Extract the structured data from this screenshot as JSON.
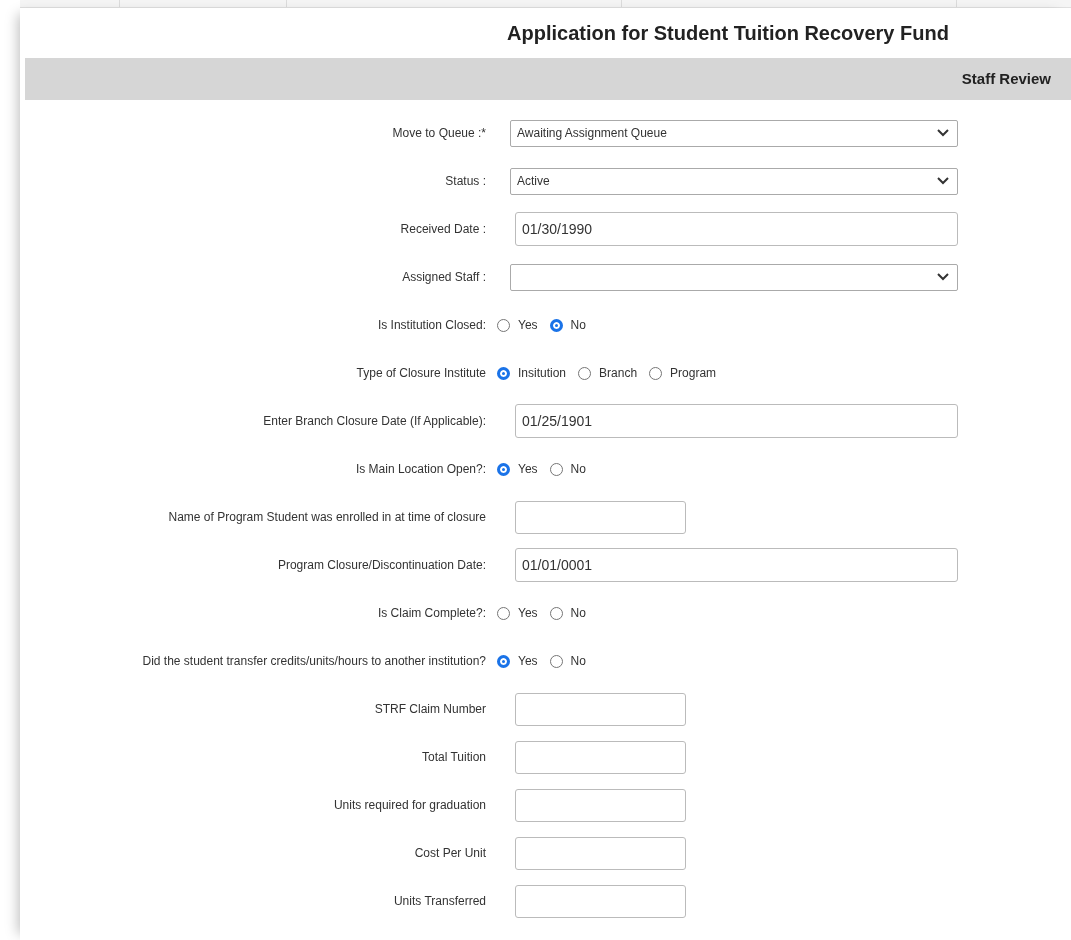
{
  "title": "Application for Student Tuition Recovery Fund",
  "section": "Staff Review",
  "fields": [
    {
      "kind": "select",
      "label": "Move to Queue :*",
      "value": "Awaiting Assignment Queue"
    },
    {
      "kind": "select",
      "label": "Status :",
      "value": "Active"
    },
    {
      "kind": "wide",
      "label": "Received Date :",
      "value": "01/30/1990"
    },
    {
      "kind": "select",
      "label": "Assigned Staff :"
    },
    {
      "kind": "radio",
      "label": "Is Institution Closed:",
      "options": [
        {
          "label": "Yes",
          "selected": false
        },
        {
          "label": "No",
          "selected": true
        }
      ]
    },
    {
      "kind": "radio",
      "label": "Type of Closure Institute",
      "options": [
        {
          "label": "Insitution",
          "selected": true
        },
        {
          "label": "Branch",
          "selected": false
        },
        {
          "label": "Program",
          "selected": false
        }
      ]
    },
    {
      "kind": "wide",
      "label": "Enter Branch Closure Date (If Applicable):",
      "value": "01/25/1901"
    },
    {
      "kind": "radio",
      "label": "Is Main Location Open?:",
      "options": [
        {
          "label": "Yes",
          "selected": true
        },
        {
          "label": "No",
          "selected": false
        }
      ]
    },
    {
      "kind": "small",
      "label": "Name of Program Student was enrolled in at time of closure"
    },
    {
      "kind": "wide",
      "label": "Program Closure/Discontinuation Date:",
      "value": "01/01/0001"
    },
    {
      "kind": "radio",
      "label": "Is Claim Complete?:",
      "options": [
        {
          "label": "Yes",
          "selected": false
        },
        {
          "label": "No",
          "selected": false
        }
      ]
    },
    {
      "kind": "radio",
      "label": "Did the student transfer credits/units/hours to another institution?",
      "options": [
        {
          "label": "Yes",
          "selected": true
        },
        {
          "label": "No",
          "selected": false
        }
      ]
    },
    {
      "kind": "small",
      "label": "STRF Claim Number"
    },
    {
      "kind": "small",
      "label": "Total Tuition"
    },
    {
      "kind": "small",
      "label": "Units required for graduation"
    },
    {
      "kind": "small",
      "label": "Cost Per Unit"
    },
    {
      "kind": "small",
      "label": "Units Transferred"
    }
  ]
}
